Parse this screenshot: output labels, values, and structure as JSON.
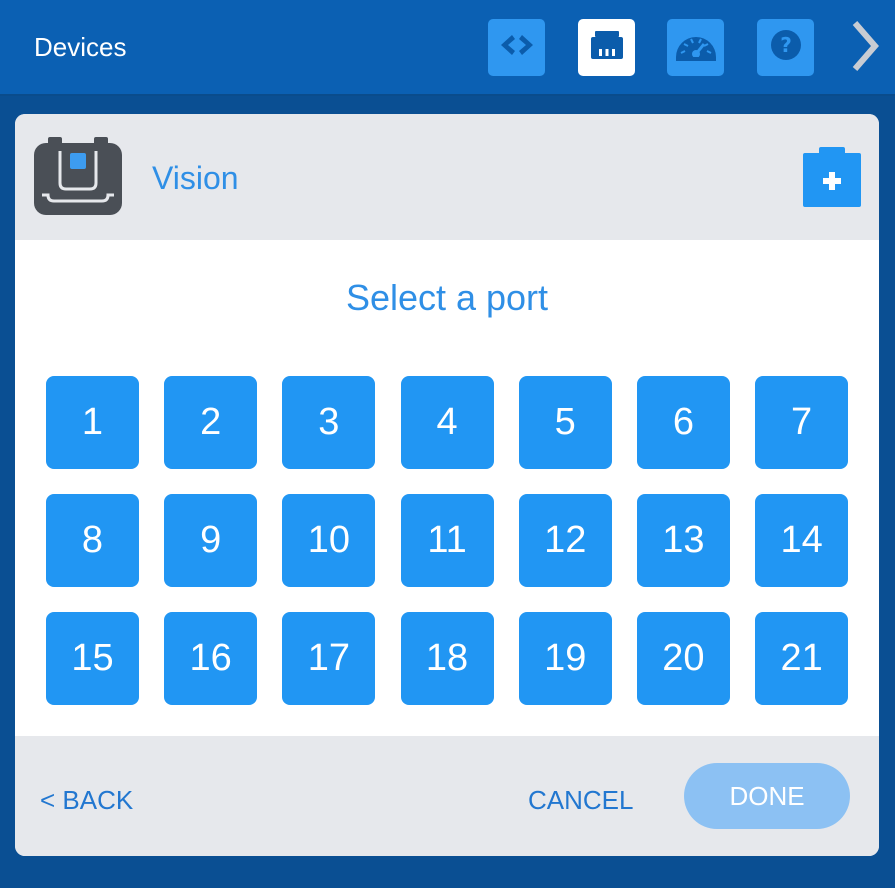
{
  "header": {
    "title": "Devices",
    "buttons": [
      {
        "name": "code-icon",
        "active": false
      },
      {
        "name": "devices-port-icon",
        "active": true
      },
      {
        "name": "dashboard-gauge-icon",
        "active": false
      },
      {
        "name": "help-icon",
        "active": false
      }
    ],
    "next_icon": "chevron-right-icon"
  },
  "dialog": {
    "device_name": "Vision",
    "device_icon": "vision-sensor-icon",
    "add_icon": "add-device-icon",
    "title": "Select a port",
    "ports": [
      "1",
      "2",
      "3",
      "4",
      "5",
      "6",
      "7",
      "8",
      "9",
      "10",
      "11",
      "12",
      "13",
      "14",
      "15",
      "16",
      "17",
      "18",
      "19",
      "20",
      "21"
    ],
    "back_label": "< BACK",
    "cancel_label": "CANCEL",
    "done_label": "DONE",
    "done_enabled": false
  },
  "colors": {
    "header_bg": "#0b60b3",
    "page_bg": "#0a4f93",
    "accent": "#2196f3",
    "text_link": "#2277d0",
    "done_disabled": "#8cc1f3"
  }
}
